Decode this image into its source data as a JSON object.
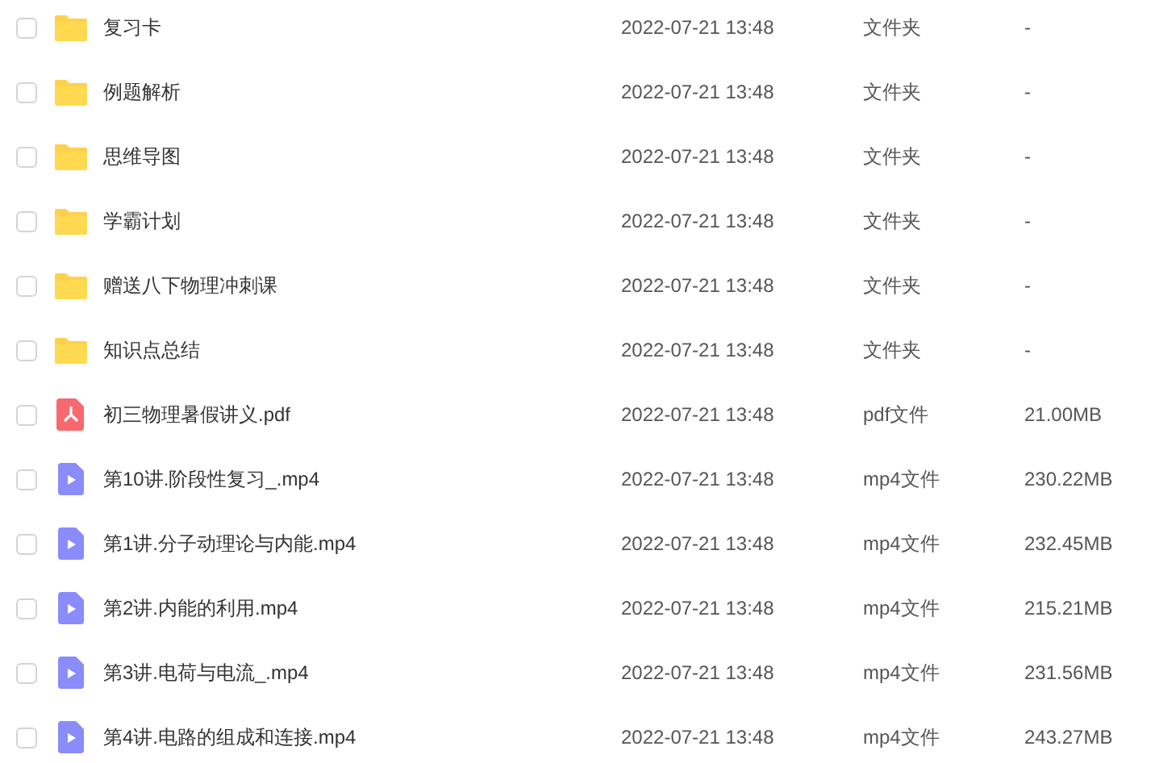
{
  "files": [
    {
      "kind": "folder",
      "name": "复习卡",
      "modified": "2022-07-21 13:48",
      "type": "文件夹",
      "size": "-",
      "checked": false
    },
    {
      "kind": "folder",
      "name": "例题解析",
      "modified": "2022-07-21 13:48",
      "type": "文件夹",
      "size": "-",
      "checked": false
    },
    {
      "kind": "folder",
      "name": "思维导图",
      "modified": "2022-07-21 13:48",
      "type": "文件夹",
      "size": "-",
      "checked": false
    },
    {
      "kind": "folder",
      "name": "学霸计划",
      "modified": "2022-07-21 13:48",
      "type": "文件夹",
      "size": "-",
      "checked": false
    },
    {
      "kind": "folder",
      "name": "赠送八下物理冲刺课",
      "modified": "2022-07-21 13:48",
      "type": "文件夹",
      "size": "-",
      "checked": false
    },
    {
      "kind": "folder",
      "name": "知识点总结",
      "modified": "2022-07-21 13:48",
      "type": "文件夹",
      "size": "-",
      "checked": false
    },
    {
      "kind": "pdf",
      "name": "初三物理暑假讲义.pdf",
      "modified": "2022-07-21 13:48",
      "type": "pdf文件",
      "size": "21.00MB",
      "checked": false
    },
    {
      "kind": "video",
      "name": "第10讲.阶段性复习_.mp4",
      "modified": "2022-07-21 13:48",
      "type": "mp4文件",
      "size": "230.22MB",
      "checked": false
    },
    {
      "kind": "video",
      "name": "第1讲.分子动理论与内能.mp4",
      "modified": "2022-07-21 13:48",
      "type": "mp4文件",
      "size": "232.45MB",
      "checked": false
    },
    {
      "kind": "video",
      "name": "第2讲.内能的利用.mp4",
      "modified": "2022-07-21 13:48",
      "type": "mp4文件",
      "size": "215.21MB",
      "checked": false
    },
    {
      "kind": "video",
      "name": "第3讲.电荷与电流_.mp4",
      "modified": "2022-07-21 13:48",
      "type": "mp4文件",
      "size": "231.56MB",
      "checked": false
    },
    {
      "kind": "video",
      "name": "第4讲.电路的组成和连接.mp4",
      "modified": "2022-07-21 13:48",
      "type": "mp4文件",
      "size": "243.27MB",
      "checked": false
    }
  ]
}
